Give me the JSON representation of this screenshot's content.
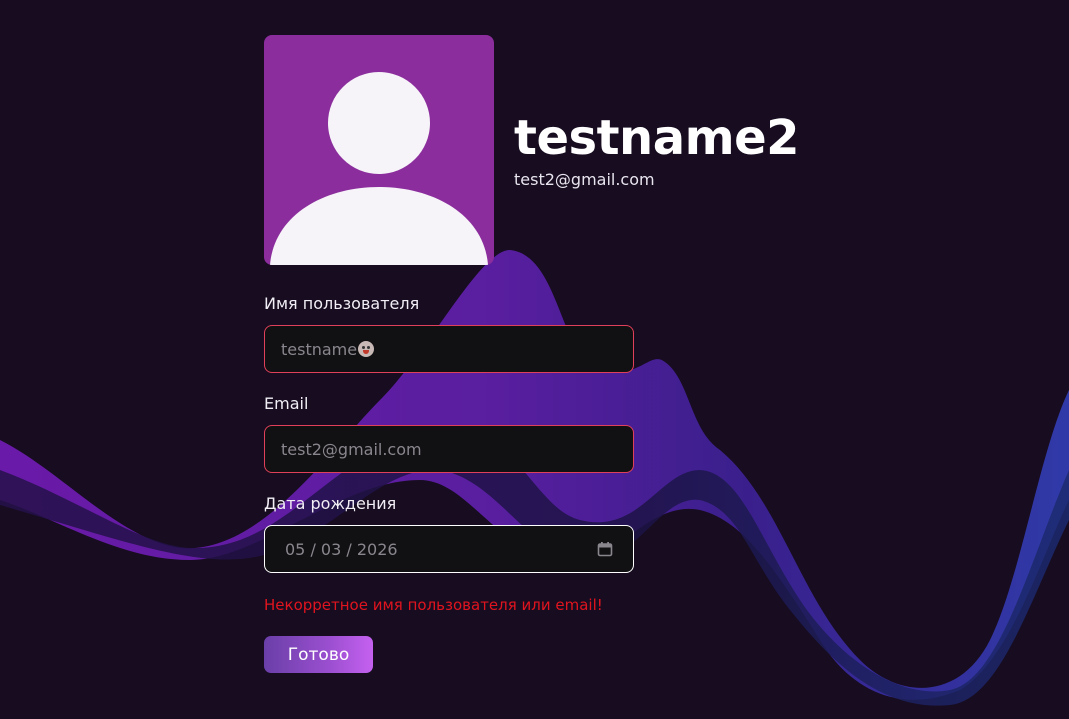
{
  "profile": {
    "username": "testname2",
    "email": "test2@gmail.com",
    "avatar_icon": "user-silhouette-icon",
    "avatar_color": "#8b2d9c"
  },
  "form": {
    "username_label": "Имя пользователя",
    "username_value": "testname",
    "username_emoji_icon": "clown-face-emoji",
    "email_label": "Email",
    "email_value": "test2@gmail.com",
    "dob_label": "Дата рождения",
    "dob_value": "05 / 03 / 2026",
    "dob_icon": "calendar-icon",
    "error_message": "Некорретное имя пользователя или email!",
    "submit_label": "Готово"
  },
  "colors": {
    "background": "#170c20",
    "error": "#e0141e",
    "invalid_border": "#e0405a",
    "button_gradient_start": "#6a3fa8",
    "button_gradient_end": "#c561f0"
  }
}
